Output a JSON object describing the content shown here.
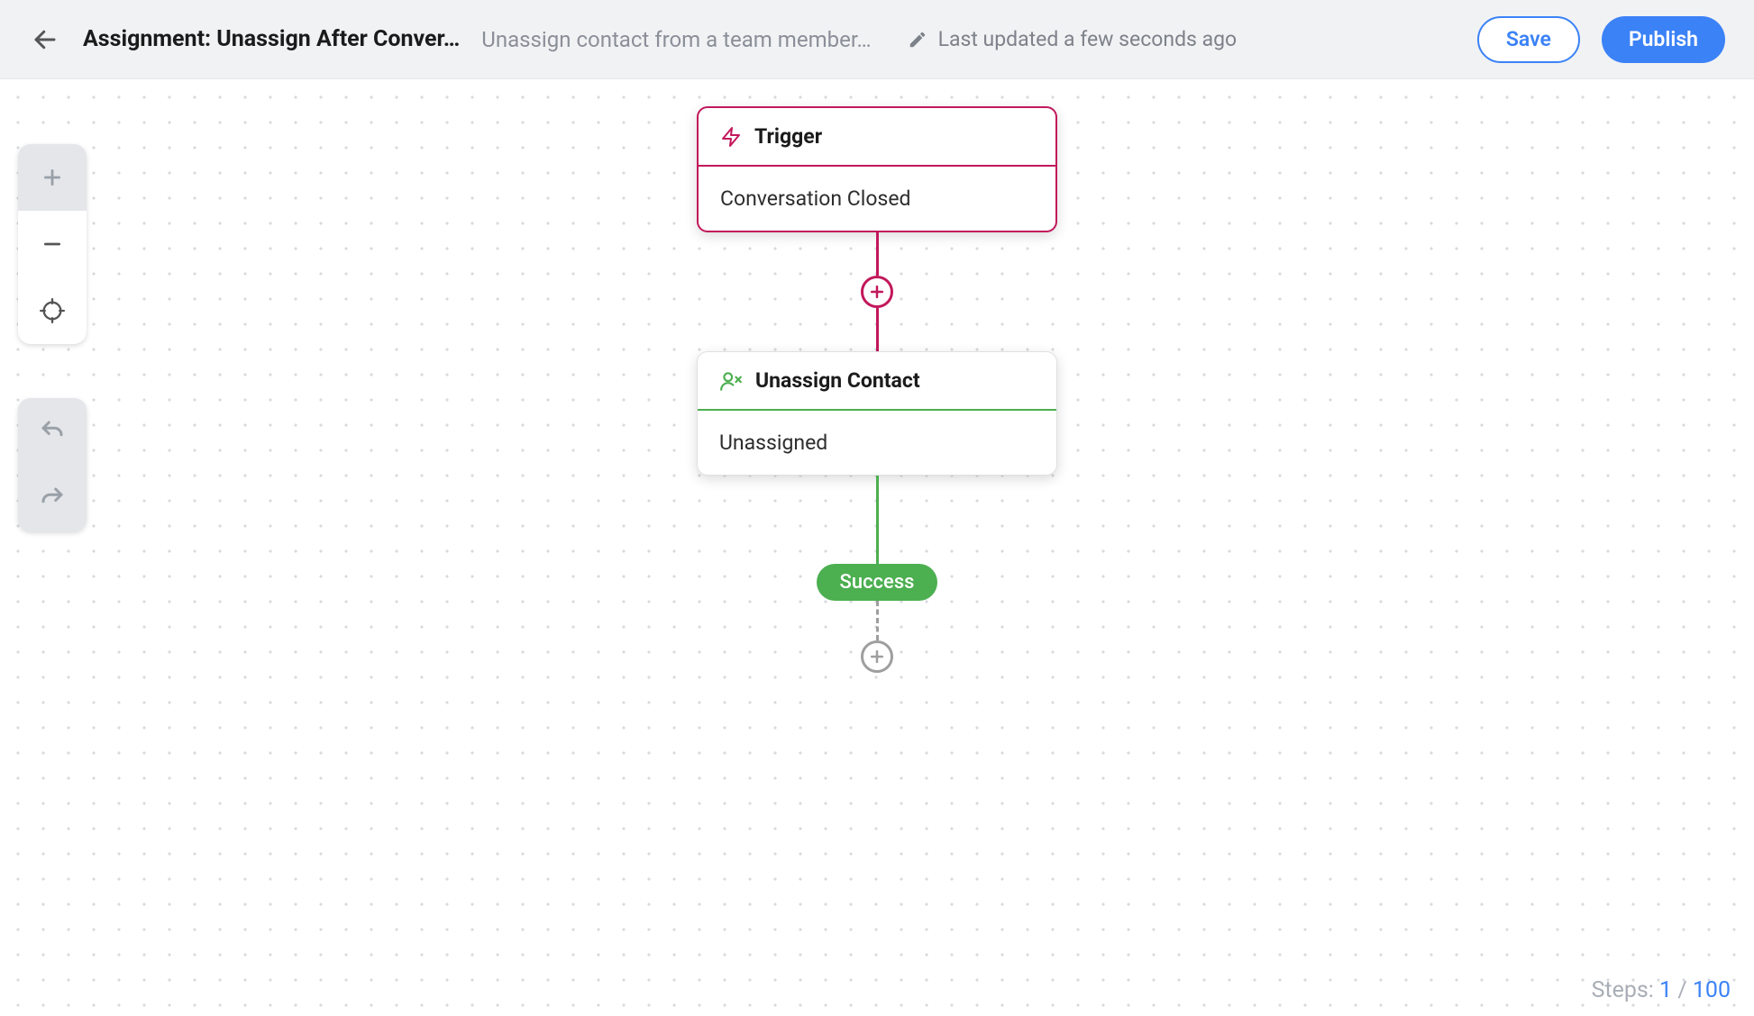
{
  "header": {
    "title": "Assignment: Unassign After Conver…",
    "subtitle": "Unassign contact from a team member…",
    "updated": "Last updated a few seconds ago",
    "save_label": "Save",
    "publish_label": "Publish"
  },
  "flow": {
    "trigger": {
      "title": "Trigger",
      "body": "Conversation Closed"
    },
    "action": {
      "title": "Unassign Contact",
      "body": "Unassigned"
    },
    "success_label": "Success"
  },
  "footer": {
    "steps_label": "Steps:",
    "current": "1",
    "sep": "/",
    "total": "100"
  }
}
